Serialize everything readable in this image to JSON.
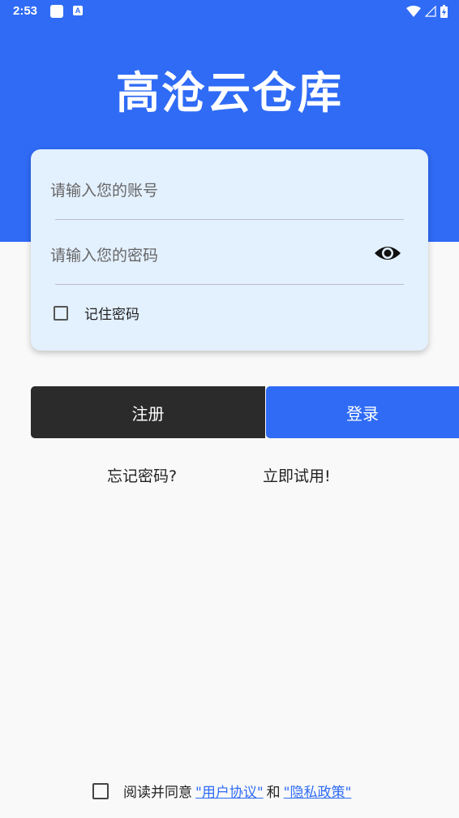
{
  "status_bar": {
    "time": "2:53",
    "notif_icon_letter": "A"
  },
  "app": {
    "title": "高沧云仓库"
  },
  "form": {
    "account_placeholder": "请输入您的账号",
    "password_placeholder": "请输入您的密码",
    "remember_label": "记住密码"
  },
  "buttons": {
    "register": "注册",
    "login": "登录"
  },
  "links": {
    "forgot": "忘记密码?",
    "trial": "立即试用!"
  },
  "agreement": {
    "prefix": "阅读并同意",
    "user_agreement": "\"用户协议\"",
    "and": "和",
    "privacy_policy": "\"隐私政策\""
  },
  "colors": {
    "primary": "#2f6bf5",
    "card_bg": "#e3f0fe",
    "register_btn": "#2b2b2b",
    "page_bg": "#f9f9f9"
  },
  "icons": [
    "wifi-icon",
    "signal-icon",
    "battery-icon",
    "eye-icon",
    "checkbox-icon"
  ]
}
